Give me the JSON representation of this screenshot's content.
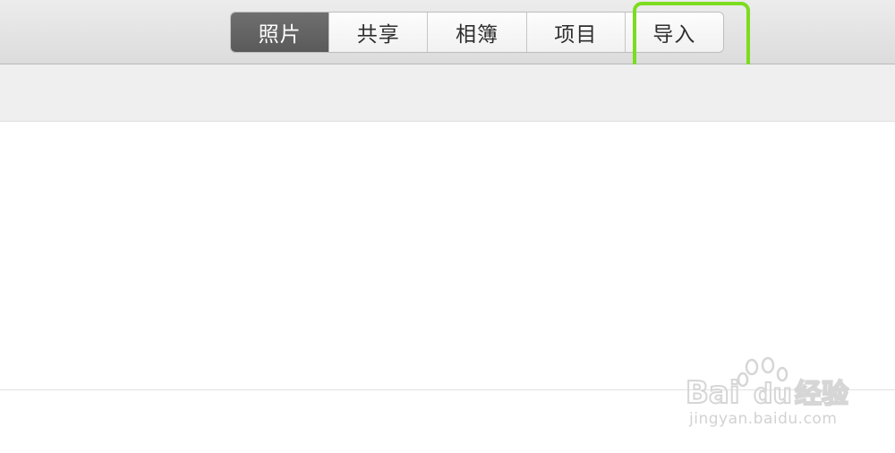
{
  "toolbar": {
    "tabs": [
      {
        "label": "照片",
        "active": true
      },
      {
        "label": "共享",
        "active": false
      },
      {
        "label": "相簿",
        "active": false
      },
      {
        "label": "项目",
        "active": false
      },
      {
        "label": "导入",
        "active": false
      }
    ]
  },
  "highlight": {
    "color": "#7ddc1f",
    "target": "导入"
  },
  "watermark": {
    "logo": "Bai du 经验",
    "url": "jingyan.baidu.com"
  }
}
